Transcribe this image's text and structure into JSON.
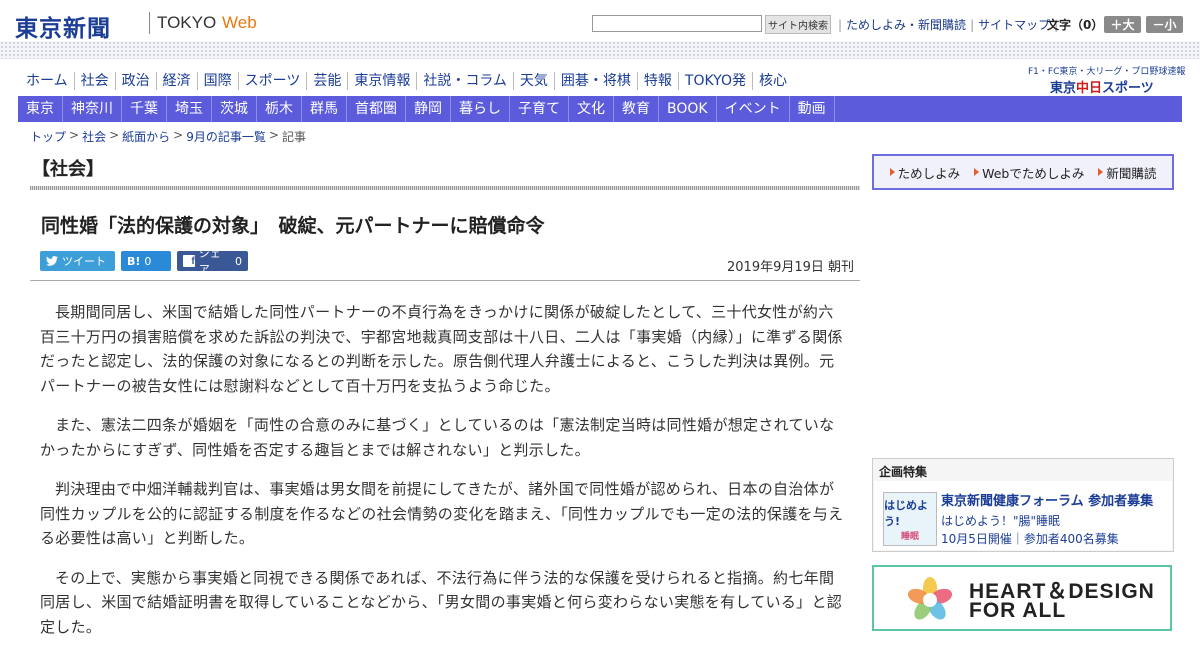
{
  "header": {
    "logo_jp": "東京新聞",
    "logo_tokyo": "TOKYO",
    "logo_web": "Web",
    "search_placeholder": "",
    "search_button": "サイト内検索",
    "links": [
      "ためしよみ・新聞購読",
      "サイトマップ"
    ],
    "font_size_label": "文字（0）",
    "font_large": "＋大",
    "font_small": "－小"
  },
  "main_nav": [
    "ホーム",
    "社会",
    "政治",
    "経済",
    "国際",
    "スポーツ",
    "芸能",
    "東京情報",
    "社説・コラム",
    "天気",
    "囲碁・将棋",
    "特報",
    "TOKYO発",
    "核心"
  ],
  "sub_nav": [
    "東京",
    "神奈川",
    "千葉",
    "埼玉",
    "茨城",
    "栃木",
    "群馬",
    "首都圏",
    "静岡",
    "暮らし",
    "子育て",
    "文化",
    "教育",
    "BOOK",
    "イベント",
    "動画"
  ],
  "chunichi": {
    "tagline": "F1・FC東京・大リーグ・プロ野球速報",
    "logo_prefix": "東京",
    "logo_red": "中日",
    "logo_suffix": "スポーツ"
  },
  "breadcrumb": [
    "トップ",
    "社会",
    "紙面から",
    "9月の記事一覧",
    "記事"
  ],
  "breadcrumb_sep": ">",
  "section_title": "【社会】",
  "article": {
    "title": "同性婚「法的保護の対象」　破綻、元パートナーに賠償命令",
    "date": "2019年9月19日 朝刊",
    "share": {
      "tweet": "ツイート",
      "hatena_label": "B!",
      "hatena_count": "0",
      "fb_label": "シェア",
      "fb_count": "0"
    },
    "paragraphs": [
      "長期間同居し、米国で結婚した同性パートナーの不貞行為をきっかけに関係が破綻したとして、三十代女性が約六百三十万円の損害賠償を求めた訴訟の判決で、宇都宮地裁真岡支部は十八日、二人は「事実婚（内縁）」に準ずる関係だったと認定し、法的保護の対象になるとの判断を示した。原告側代理人弁護士によると、こうした判決は異例。元パートナーの被告女性には慰謝料などとして百十万円を支払うよう命じた。",
      "また、憲法二四条が婚姻を「両性の合意のみに基づく」としているのは「憲法制定当時は同性婚が想定されていなかったからにすぎず、同性婚を否定する趣旨とまでは解されない」と判示した。",
      "判決理由で中畑洋輔裁判官は、事実婚は男女間を前提にしてきたが、諸外国で同性婚が認められ、日本の自治体が同性カップルを公的に認証する制度を作るなどの社会情勢の変化を踏まえ、「同性カップルでも一定の法的保護を与える必要性は高い」と判断した。",
      "その上で、実態から事実婚と同視できる関係であれば、不法行為に伴う法的な保護を受けられると指摘。約七年間同居し、米国で結婚証明書を取得していることなどから、「男女間の事実婚と何ら変わらない実態を有している」と認定した。"
    ]
  },
  "sidebar": {
    "trial_links": [
      "ためしよみ",
      "Webでためしよみ",
      "新聞購読"
    ],
    "kikaku": {
      "heading": "企画特集",
      "thumb_line1": "はじめよう!",
      "thumb_line2": "睡眠",
      "title": "東京新聞健康フォーラム 参加者募集",
      "subtitle": "はじめよう！\"腸\"睡眠",
      "detail": "10月5日開催｜参加者400名募集"
    },
    "banner": {
      "line1": "HEART＆DESIGN",
      "line2": "FOR ALL"
    }
  }
}
